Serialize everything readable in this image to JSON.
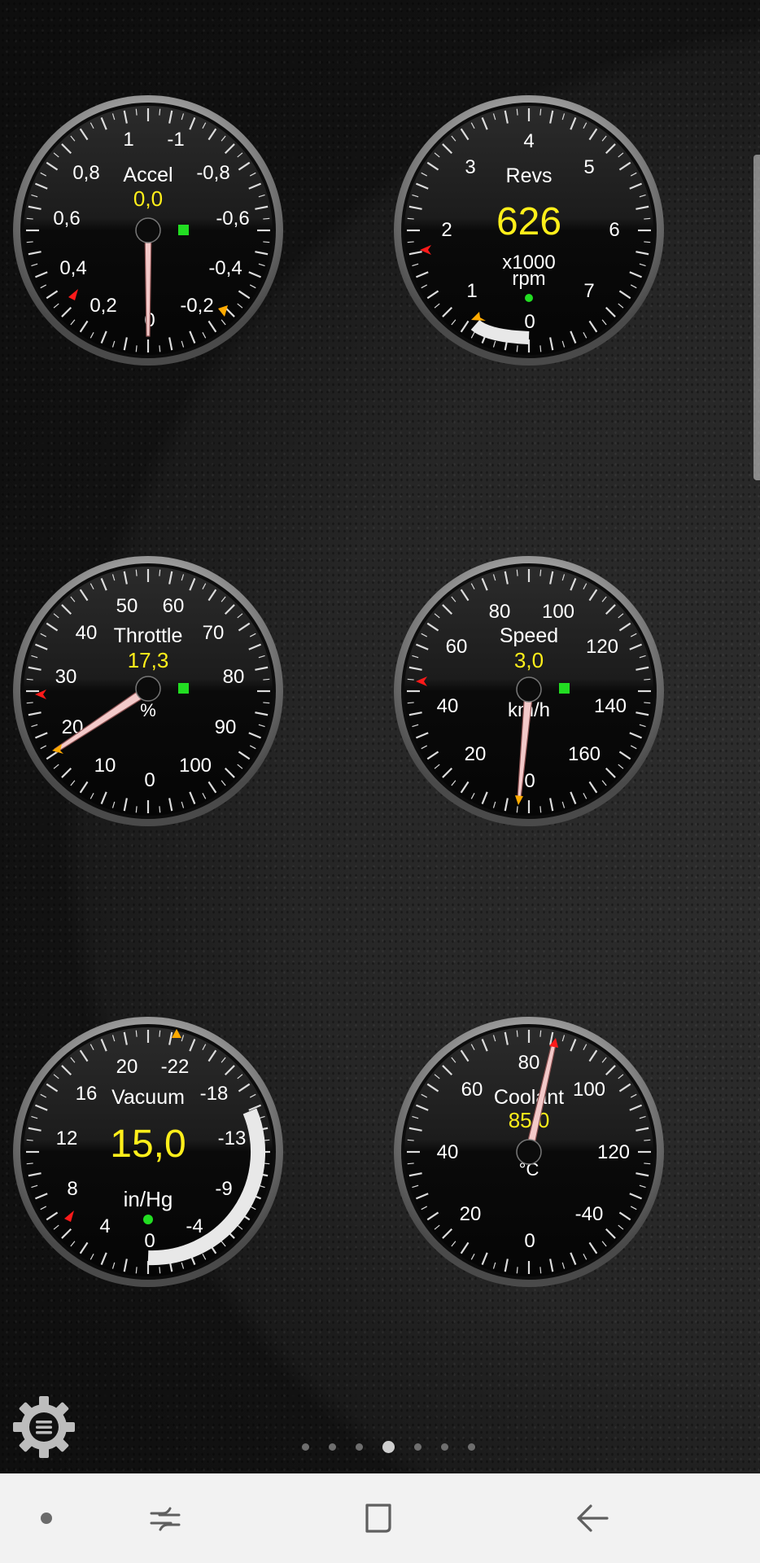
{
  "gauges": [
    {
      "id": "accel",
      "title": "Accel",
      "value": "0,0",
      "unit": "",
      "big_value": false,
      "tick_labels": [
        "1",
        "-1",
        "0,8",
        "-0,8",
        "0,6",
        "-0,6",
        "0,4",
        "-0,4",
        "0,2",
        "-0,2",
        "0"
      ],
      "needle_reading": 0.0,
      "status_light": "green"
    },
    {
      "id": "revs",
      "title": "Revs",
      "value": "626",
      "unit": "x1000\nrpm",
      "unit_line1": "x1000",
      "unit_line2": "rpm",
      "big_value": true,
      "tick_labels": [
        "0",
        "1",
        "2",
        "3",
        "4",
        "5",
        "6",
        "7"
      ],
      "arc_fill_fraction": 0.09,
      "status_light": "green"
    },
    {
      "id": "throttle",
      "title": "Throttle",
      "value": "17,3",
      "unit": "%",
      "big_value": false,
      "tick_labels": [
        "0",
        "10",
        "20",
        "30",
        "40",
        "50",
        "60",
        "70",
        "80",
        "90",
        "100"
      ],
      "needle_reading": 17.3,
      "status_light": "green"
    },
    {
      "id": "speed",
      "title": "Speed",
      "value": "3,0",
      "unit": "km/h",
      "big_value": false,
      "tick_labels": [
        "0",
        "20",
        "40",
        "60",
        "80",
        "100",
        "120",
        "140",
        "160"
      ],
      "needle_reading": 3.0,
      "status_light": "green"
    },
    {
      "id": "vacuum",
      "title": "Vacuum",
      "value": "15,0",
      "unit": "in/Hg",
      "big_value": true,
      "tick_labels": [
        "0",
        "4",
        "8",
        "12",
        "16",
        "20",
        "-22",
        "-18",
        "-13",
        "-9",
        "-4"
      ],
      "arc_fill_fraction": 0.36,
      "status_light": "green"
    },
    {
      "id": "coolant",
      "title": "Coolant",
      "value": "85,0",
      "unit": "°C",
      "big_value": false,
      "tick_labels": [
        "0",
        "20",
        "40",
        "60",
        "80",
        "100",
        "120",
        "-40"
      ],
      "needle_reading": 85.0,
      "status_light": "none"
    }
  ],
  "pager": {
    "page_count": 7,
    "active_index": 3
  },
  "settings": {
    "icon": "gear-menu-icon"
  },
  "navbar": {
    "items": [
      {
        "id": "dot",
        "icon": "nav-dot-icon"
      },
      {
        "id": "recents",
        "icon": "recents-icon"
      },
      {
        "id": "home",
        "icon": "home-icon"
      },
      {
        "id": "back",
        "icon": "back-arrow-icon"
      }
    ]
  },
  "colors": {
    "value_yellow": "#ffef1a",
    "label_white": "#ffffff",
    "status_green": "#22dd22",
    "min_marker_red": "#ff1a1a",
    "max_marker_orange": "#ffaa00",
    "needle_pink": "#f3c9c9"
  }
}
